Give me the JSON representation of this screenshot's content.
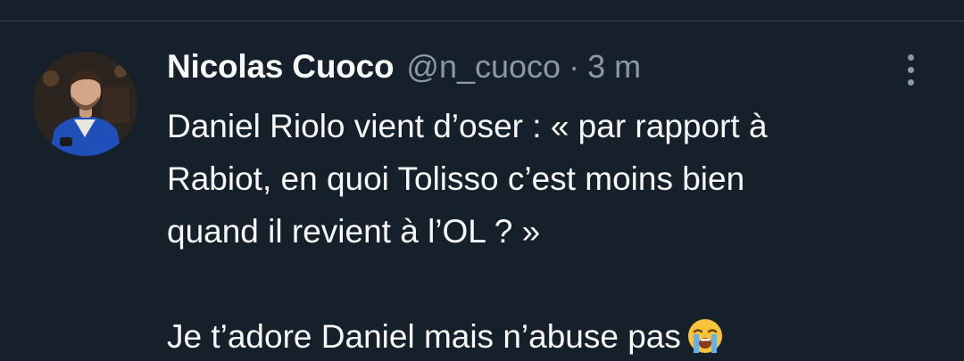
{
  "tweet": {
    "display_name": "Nicolas Cuoco",
    "handle": "@n_cuoco",
    "separator": "·",
    "time": "3 m",
    "lines": [
      "Daniel Riolo vient d’oser : « par rapport à",
      "Rabiot, en quoi Tolisso c’est moins bien",
      "quand il revient à l’OL ? »"
    ],
    "last_line": "Je t’adore Daniel mais n’abuse pas",
    "emoji": "loudly-crying-face"
  },
  "colors": {
    "background": "#15202b",
    "divider": "#38444d",
    "primary_text": "#f7f9f9",
    "secondary_text": "#8b98a5"
  },
  "icons": {
    "more": "more-vertical-icon"
  }
}
